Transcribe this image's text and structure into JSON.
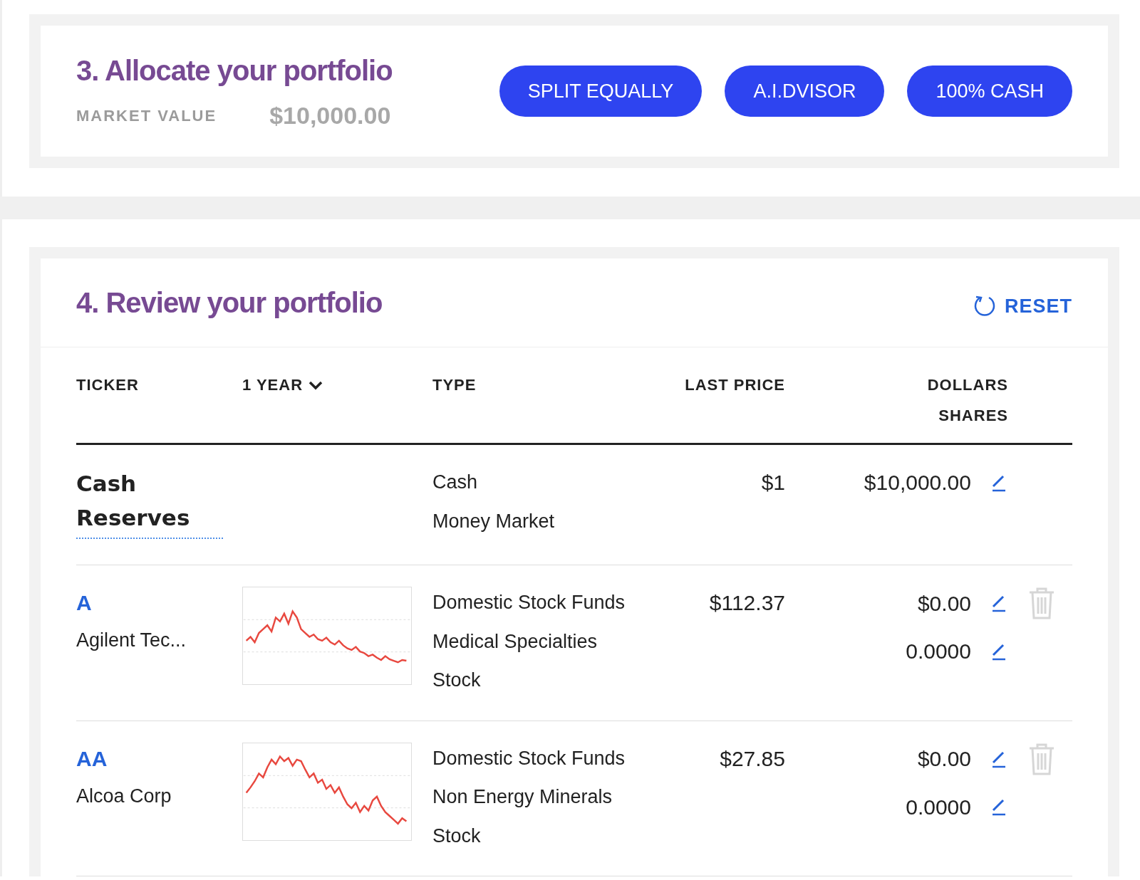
{
  "allocate": {
    "title": "3. Allocate your portfolio",
    "market_value_label": "MARKET VALUE",
    "market_value": "$10,000.00",
    "buttons": [
      "SPLIT EQUALLY",
      "A.I.DVISOR",
      "100% CASH"
    ]
  },
  "review": {
    "title": "4. Review your portfolio",
    "reset": "RESET",
    "columns": [
      {
        "label": "TICKER",
        "dropdown": false
      },
      {
        "label": "1 YEAR",
        "dropdown": true
      },
      {
        "label": "TYPE",
        "dropdown": false
      },
      {
        "label": "LAST PRICE",
        "dropdown": false
      },
      {
        "label": "DOLLARS",
        "sublabel": "SHARES",
        "dropdown": false
      }
    ],
    "rows": [
      {
        "kind": "cash",
        "ticker": "Cash Reserves",
        "types": [
          "Cash",
          "Money Market"
        ],
        "last_price": "$1",
        "dollars": "$10,000.00"
      },
      {
        "kind": "stock",
        "ticker": "A",
        "name": "Agilent Tec...",
        "types": [
          "Domestic Stock Funds",
          "Medical Specialties",
          "Stock"
        ],
        "last_price": "$112.37",
        "dollars": "$0.00",
        "shares": "0.0000"
      },
      {
        "kind": "stock",
        "ticker": "AA",
        "name": "Alcoa Corp",
        "types": [
          "Domestic Stock Funds",
          "Non Energy Minerals",
          "Stock"
        ],
        "last_price": "$27.85",
        "dollars": "$0.00",
        "shares": "0.0000"
      }
    ]
  }
}
